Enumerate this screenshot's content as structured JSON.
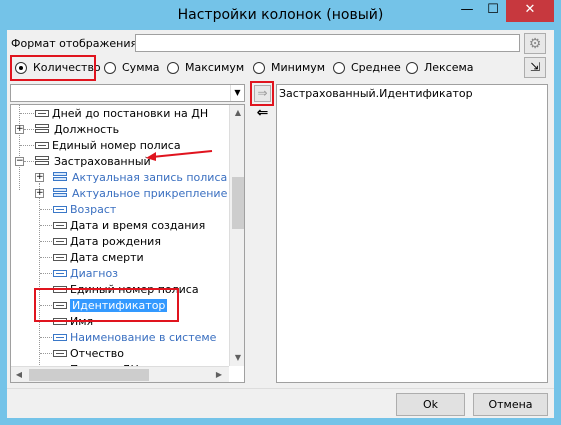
{
  "window": {
    "title": "Настройки колонок (новый)",
    "minimize": "—",
    "maximize": "☐",
    "close": "✕"
  },
  "format": {
    "label": "Формат отображения",
    "value": "",
    "settings_icon": "gear-icon"
  },
  "aggregates": {
    "selected": "Количество",
    "options": [
      "Количество",
      "Сумма",
      "Максимум",
      "Минимум",
      "Среднее",
      "Лексема"
    ]
  },
  "source": {
    "filter_value": "",
    "items": [
      {
        "label": "Дней до постановки на ДН",
        "type": "field"
      },
      {
        "label": "Должность",
        "type": "group",
        "expand": "+"
      },
      {
        "label": "Единый номер полиса",
        "type": "field"
      },
      {
        "label": "Застрахованный",
        "type": "group",
        "expand": "−"
      },
      {
        "label": "Актуальная запись полиса",
        "type": "group",
        "expand": "+",
        "style": "link"
      },
      {
        "label": "Актуальное прикрепление к МО",
        "type": "group",
        "expand": "+",
        "style": "link"
      },
      {
        "label": "Возраст",
        "type": "field",
        "style": "link"
      },
      {
        "label": "Дата и время создания",
        "type": "field"
      },
      {
        "label": "Дата рождения",
        "type": "field"
      },
      {
        "label": "Дата смерти",
        "type": "field"
      },
      {
        "label": "Диагноз",
        "type": "field",
        "style": "link"
      },
      {
        "label": "Единый номер полиса",
        "type": "field"
      },
      {
        "label": "Идентификатор",
        "type": "field",
        "selected": true
      },
      {
        "label": "Имя",
        "type": "field"
      },
      {
        "label": "Наименование в системе",
        "type": "field",
        "style": "link"
      },
      {
        "label": "Отчество",
        "type": "field"
      },
      {
        "label": "Паспорт ДН",
        "type": "field"
      }
    ]
  },
  "target": {
    "items": [
      "Застрахованный.Идентификатор"
    ]
  },
  "buttons": {
    "move_right": "⇒",
    "move_left": "⇐",
    "ok": "Ok",
    "cancel": "Отмена"
  },
  "colors": {
    "titlebar": "#74c3e8",
    "close_button": "#c7383e",
    "highlight": "#e0141e",
    "link_text": "#3a6fc0",
    "selection": "#3399ff"
  }
}
